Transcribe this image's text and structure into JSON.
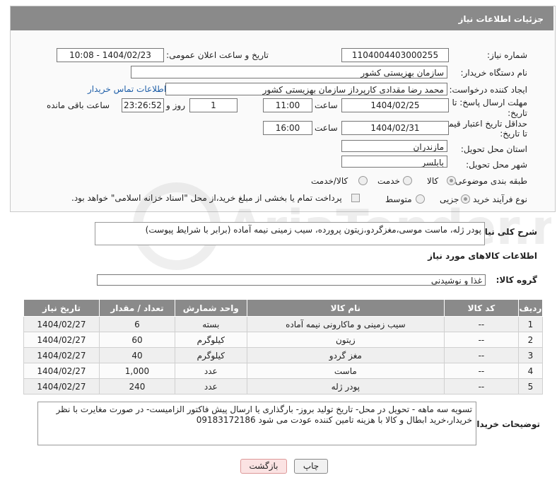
{
  "header": {
    "title": "جزئیات اطلاعات نیاز"
  },
  "form": {
    "need_number": {
      "label": "شماره نیاز:",
      "value": "1104004403000255"
    },
    "announce_datetime": {
      "label": "تاریخ و ساعت اعلان عمومی:",
      "value": "1404/02/23 - 10:08"
    },
    "buyer_org": {
      "label": "نام دستگاه خریدار:",
      "value": "سازمان بهزیستی کشور"
    },
    "requester": {
      "label": "ایجاد کننده درخواست:",
      "value": "محمد رضا  مقدادی کارپرداز سازمان بهزیستی کشور",
      "contact_link": "اطلاعات تماس خریدار"
    },
    "reply_deadline": {
      "label_line1": "مهلت ارسال پاسخ: تا",
      "label_line2": "تاریخ:",
      "date": "1404/02/25",
      "time_label": "ساعت",
      "time": "11:00",
      "days": "1",
      "days_label": "روز و",
      "remaining": "23:26:52",
      "remaining_label": "ساعت باقی مانده"
    },
    "price_validity": {
      "label_line1": "حداقل تاریخ اعتبار قیمت:",
      "label_line2": "تا تاریخ:",
      "date": "1404/02/31",
      "time_label": "ساعت",
      "time": "16:00"
    },
    "delivery_province": {
      "label": "استان محل تحویل:",
      "value": "مازندران"
    },
    "delivery_city": {
      "label": "شهر محل تحویل:",
      "value": "بابلسر"
    },
    "category": {
      "label": "طبقه بندی موضوعی:",
      "options": [
        "کالا",
        "خدمت",
        "کالا/خدمت"
      ],
      "selected": "کالا"
    },
    "purchase_type": {
      "label": "نوع فرآیند خرید :",
      "options": [
        "جزیی",
        "متوسط"
      ],
      "selected": "جزیی",
      "payment_note": "پرداخت تمام یا بخشی از مبلغ خرید،از محل \"اسناد خزانه اسلامی\" خواهد بود."
    }
  },
  "description": {
    "label": "شرح کلی نیاز:",
    "value": "پودر ژله، ماست موسی،مغزگردو،زیتون پرورده، سیب زمینی نیمه آماده (برابر با شرایط پیوست)"
  },
  "goods_section": {
    "title": "اطلاعات کالاهای مورد نیاز",
    "group_label": "گروه کالا:",
    "group_value": "غذا و نوشیدنی"
  },
  "table": {
    "headers": [
      "ردیف",
      "کد کالا",
      "نام کالا",
      "واحد شمارش",
      "تعداد / مقدار",
      "تاریخ نیاز"
    ],
    "rows": [
      [
        "1",
        "--",
        "سیب زمینی و ماکارونی نیمه آماده",
        "بسته",
        "6",
        "1404/02/27"
      ],
      [
        "2",
        "--",
        "زیتون",
        "کیلوگرم",
        "60",
        "1404/02/27"
      ],
      [
        "3",
        "--",
        "مغز گردو",
        "کیلوگرم",
        "40",
        "1404/02/27"
      ],
      [
        "4",
        "--",
        "ماست",
        "عدد",
        "1,000",
        "1404/02/27"
      ],
      [
        "5",
        "--",
        "پودر ژله",
        "عدد",
        "240",
        "1404/02/27"
      ]
    ]
  },
  "buyer_notes": {
    "label": "توضیحات خریدار:",
    "value": "تسویه سه ماهه - تحویل در محل- تاریخ تولید بروز- بارگذاری یا ارسال پیش فاکتور الزامیست- در صورت مغایرت با نظر خریدار،خرید ابطال و کالا با هزینه تامین کننده عودت می شود 09183172186"
  },
  "buttons": {
    "print": "چاپ",
    "back": "بازگشت"
  },
  "watermark": {
    "text": "AriaTender.net"
  }
}
